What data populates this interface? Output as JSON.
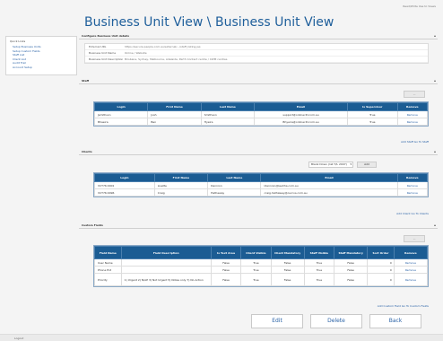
{
  "header": {
    "user": "Read/Write Use to Views"
  },
  "page_title": "Business Unit View \\ Business Unit View",
  "quick_links": {
    "title": "Quick Links",
    "items": [
      "Setup Business Units",
      "Setup Custom Fields",
      "Staff List",
      "Client List",
      "Audit Trail",
      "Account Setup"
    ]
  },
  "configure": {
    "title": "Configure Business Unit details",
    "fields": [
      {
        "label": "External URL",
        "value": "https://secure.people.com.au/external/.../staff_listing.jsp"
      },
      {
        "label": "Business Unit Name",
        "value": "Online / Website"
      },
      {
        "label": "Business Unit Description",
        "value": "Brisbane, Sydney, Melbourne, Adelaide, Perth Contact centre / CWM centres"
      }
    ]
  },
  "staff": {
    "title": "Staff",
    "pager_label": "...",
    "columns": [
      "Login",
      "First Name",
      "Last Name",
      "Email",
      "Is Supervisor",
      "Remove"
    ],
    "rows": [
      [
        "Jsmithson",
        "Josh",
        "Smithson",
        "support@onlinecitl.com.au",
        "True",
        "Remove"
      ],
      [
        "Bhaeira",
        "Ben",
        "Hyeira",
        "Bhyeira@onlinecitl.com.au",
        "True",
        "Remove"
      ]
    ],
    "links": "Add Staff   Go To Staff"
  },
  "clients": {
    "title": "Clients",
    "select_value": "Blank Down (1st T/L 2007)",
    "add_label": "Add",
    "columns": [
      "Login",
      "First Name",
      "Last Name",
      "Email",
      "Remove"
    ],
    "rows": [
      [
        "VCT76:0001",
        "Lisette",
        "Dennion",
        "ldennion@leehha.com.au",
        "Remove"
      ],
      [
        "VCT76:0096",
        "Craig",
        "Hathaway",
        "craig.hathaway@ourcvs.com.au",
        "Remove"
      ]
    ],
    "links": "Add Client   Go To Clients"
  },
  "custom_fields": {
    "title": "Custom Fields",
    "pager_label": "...",
    "columns": [
      "Field Name",
      "Field Description",
      "Is Text Area",
      "Client Visible",
      "Client Mandatory",
      "Staff Visible",
      "Staff Mandatory",
      "Sort Order",
      "Remove"
    ],
    "rows": [
      [
        "User Name",
        "",
        "False",
        "True",
        "False",
        "True",
        "False",
        "0",
        "Remove"
      ],
      [
        "Phone Ext",
        "",
        "False",
        "True",
        "False",
        "True",
        "False",
        "0",
        "Remove"
      ],
      [
        "Priority",
        "1) Urgent 2) N/AP 3) Not Urgent 5) Notes only 7) No Action",
        "False",
        "True",
        "False",
        "True",
        "False",
        "0",
        "Remove"
      ]
    ],
    "links": "Add Custom Field   Go To Custom Fields"
  },
  "buttons": {
    "edit": "Edit",
    "delete": "Delete",
    "back": "Back"
  },
  "footer": {
    "text": "Logout"
  },
  "colors": {
    "accent": "#1b5c93",
    "title": "#1f5f9b",
    "link": "#2a62a6"
  }
}
